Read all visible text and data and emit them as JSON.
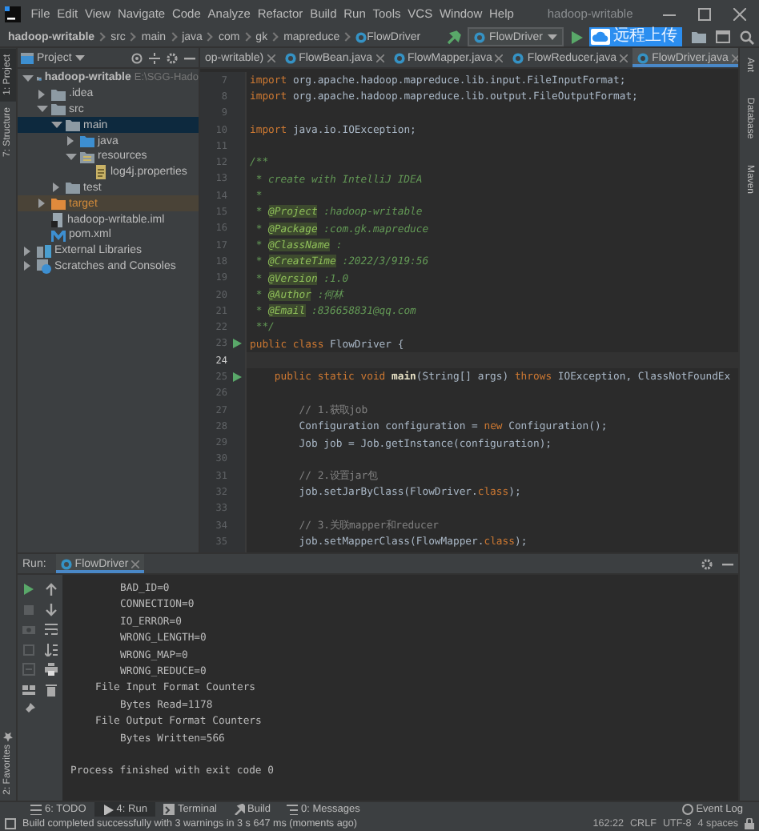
{
  "menubar": {
    "menus": [
      "File",
      "Edit",
      "View",
      "Navigate",
      "Code",
      "Analyze",
      "Refactor",
      "Build",
      "Run",
      "Tools",
      "VCS",
      "Window",
      "Help"
    ],
    "title": "hadoop-writable"
  },
  "navbar": {
    "breadcrumbs": [
      "hadoop-writable",
      "src",
      "main",
      "java",
      "com",
      "gk",
      "mapreduce",
      "FlowDriver"
    ],
    "run_config": "FlowDriver",
    "upload_button": "远程上传"
  },
  "left_strip": {
    "top": [
      {
        "label": "1: Project",
        "selected": true
      },
      {
        "label": "7: Structure",
        "selected": false
      }
    ],
    "bottom": [
      {
        "label": "2: Favorites",
        "selected": false
      }
    ]
  },
  "right_strip": [
    "Ant",
    "Database",
    "Maven"
  ],
  "project": {
    "title": "Project",
    "tree": [
      {
        "label": "hadoop-writable",
        "note": "E:\\SGG-Hado",
        "kind": "module",
        "expanded": true,
        "selected": false,
        "children": [
          {
            "label": ".idea",
            "kind": "folder",
            "expanded": false,
            "selected": false
          },
          {
            "label": "src",
            "kind": "folder",
            "expanded": true,
            "selected": false,
            "children": [
              {
                "label": "main",
                "kind": "folder",
                "expanded": true,
                "selected": true,
                "children": [
                  {
                    "label": "java",
                    "kind": "source_folder",
                    "expanded": false,
                    "selected": false
                  },
                  {
                    "label": "resources",
                    "kind": "resource_folder",
                    "expanded": true,
                    "selected": false,
                    "children": [
                      {
                        "label": "log4j.properties",
                        "kind": "properties",
                        "selected": false
                      }
                    ]
                  }
                ]
              },
              {
                "label": "test",
                "kind": "folder",
                "expanded": false,
                "selected": false
              }
            ]
          },
          {
            "label": "target",
            "kind": "excluded_folder",
            "expanded": false,
            "selected": false
          },
          {
            "label": "hadoop-writable.iml",
            "kind": "iml",
            "selected": false
          },
          {
            "label": "pom.xml",
            "kind": "pom",
            "selected": false
          }
        ]
      },
      {
        "label": "External Libraries",
        "kind": "libraries",
        "expanded": false,
        "selected": false
      },
      {
        "label": "Scratches and Consoles",
        "kind": "scratches",
        "expanded": false,
        "selected": false
      }
    ]
  },
  "editor": {
    "tabs": [
      {
        "label": "op-writable)",
        "selected": false
      },
      {
        "label": "FlowBean.java",
        "selected": false
      },
      {
        "label": "FlowMapper.java",
        "selected": false
      },
      {
        "label": "FlowReducer.java",
        "selected": false
      },
      {
        "label": "FlowDriver.java",
        "selected": true
      }
    ],
    "lines": [
      {
        "number": "7",
        "current": false,
        "tokens": [
          {
            "kind": "keyword",
            "text": "import "
          },
          {
            "kind": "plain",
            "text": "org.apache.hadoop.mapreduce.lib.input.FileInputFormat;"
          }
        ]
      },
      {
        "number": "8",
        "current": false,
        "tokens": [
          {
            "kind": "keyword",
            "text": "import "
          },
          {
            "kind": "plain",
            "text": "org.apache.hadoop.mapreduce.lib.output.FileOutputFormat;"
          }
        ]
      },
      {
        "number": "9",
        "current": false
      },
      {
        "number": "10",
        "current": false,
        "tokens": [
          {
            "kind": "keyword",
            "text": "import "
          },
          {
            "kind": "plain",
            "text": "java.io.IOException;"
          }
        ]
      },
      {
        "number": "11",
        "current": false
      },
      {
        "number": "12",
        "current": false,
        "tokens": [
          {
            "kind": "doc",
            "text": "/**"
          }
        ]
      },
      {
        "number": "13",
        "current": false,
        "tokens": [
          {
            "kind": "doc",
            "text": " * create with IntelliJ IDEA"
          }
        ]
      },
      {
        "number": "14",
        "current": false,
        "tokens": [
          {
            "kind": "doc",
            "text": " *"
          }
        ]
      },
      {
        "number": "15",
        "current": false,
        "tokens": [
          {
            "kind": "doc",
            "text": " * "
          },
          {
            "kind": "doc_tag",
            "text": "@Project"
          },
          {
            "kind": "doc",
            "text": " :hadoop-writable"
          }
        ]
      },
      {
        "number": "16",
        "current": false,
        "tokens": [
          {
            "kind": "doc",
            "text": " * "
          },
          {
            "kind": "doc_tag",
            "text": "@Package"
          },
          {
            "kind": "doc",
            "text": " :com.gk.mapreduce"
          }
        ]
      },
      {
        "number": "17",
        "current": false,
        "tokens": [
          {
            "kind": "doc",
            "text": " * "
          },
          {
            "kind": "doc_tag",
            "text": "@ClassName"
          },
          {
            "kind": "doc",
            "text": " :"
          }
        ]
      },
      {
        "number": "18",
        "current": false,
        "tokens": [
          {
            "kind": "doc",
            "text": " * "
          },
          {
            "kind": "doc_tag",
            "text": "@CreateTime"
          },
          {
            "kind": "doc",
            "text": " :2022/3/919:56"
          }
        ]
      },
      {
        "number": "19",
        "current": false,
        "tokens": [
          {
            "kind": "doc",
            "text": " * "
          },
          {
            "kind": "doc_tag",
            "text": "@Version"
          },
          {
            "kind": "doc",
            "text": " :1.0"
          }
        ]
      },
      {
        "number": "20",
        "current": false,
        "tokens": [
          {
            "kind": "doc",
            "text": " * "
          },
          {
            "kind": "doc_tag",
            "text": "@Author"
          },
          {
            "kind": "doc",
            "text": " :何林"
          }
        ]
      },
      {
        "number": "21",
        "current": false,
        "tokens": [
          {
            "kind": "doc",
            "text": " * "
          },
          {
            "kind": "doc_tag",
            "text": "@Email"
          },
          {
            "kind": "doc",
            "text": " :836658831@qq.com"
          }
        ]
      },
      {
        "number": "22",
        "current": false,
        "tokens": [
          {
            "kind": "doc",
            "text": " **/"
          }
        ]
      },
      {
        "number": "23",
        "current": false,
        "runnable": true,
        "tokens": [
          {
            "kind": "keyword",
            "text": "public class "
          },
          {
            "kind": "plain",
            "text": "FlowDriver {"
          }
        ]
      },
      {
        "number": "24",
        "current": true
      },
      {
        "number": "25",
        "current": false,
        "runnable": true,
        "tokens": [
          {
            "kind": "keyword",
            "text": "    public static void "
          },
          {
            "kind": "method",
            "text": "main"
          },
          {
            "kind": "plain",
            "text": "(String[] args) "
          },
          {
            "kind": "keyword",
            "text": "throws "
          },
          {
            "kind": "plain",
            "text": "IOException, ClassNotFoundEx"
          }
        ]
      },
      {
        "number": "26",
        "current": false
      },
      {
        "number": "27",
        "current": false,
        "tokens": [
          {
            "kind": "comment",
            "text": "        // 1.获取job"
          }
        ]
      },
      {
        "number": "28",
        "current": false,
        "tokens": [
          {
            "kind": "plain",
            "text": "        Configuration configuration = "
          },
          {
            "kind": "keyword",
            "text": "new "
          },
          {
            "kind": "plain",
            "text": "Configuration();"
          }
        ]
      },
      {
        "number": "29",
        "current": false,
        "tokens": [
          {
            "kind": "plain",
            "text": "        Job job = Job.getInstance(configuration);"
          }
        ]
      },
      {
        "number": "30",
        "current": false
      },
      {
        "number": "31",
        "current": false,
        "tokens": [
          {
            "kind": "comment",
            "text": "        // 2.设置jar包"
          }
        ]
      },
      {
        "number": "32",
        "current": false,
        "tokens": [
          {
            "kind": "plain",
            "text": "        job.setJarByClass(FlowDriver."
          },
          {
            "kind": "keyword",
            "text": "class"
          },
          {
            "kind": "plain",
            "text": ");"
          }
        ]
      },
      {
        "number": "33",
        "current": false
      },
      {
        "number": "34",
        "current": false,
        "tokens": [
          {
            "kind": "comment",
            "text": "        // 3.关联mapper和reducer"
          }
        ]
      },
      {
        "number": "35",
        "current": false,
        "tokens": [
          {
            "kind": "plain",
            "text": "        job.setMapperClass(FlowMapper."
          },
          {
            "kind": "keyword",
            "text": "class"
          },
          {
            "kind": "plain",
            "text": ");"
          }
        ]
      }
    ]
  },
  "run": {
    "label": "Run:",
    "tab": "FlowDriver",
    "console": [
      {
        "kind": "counter",
        "text": "BAD_ID=0"
      },
      {
        "kind": "counter",
        "text": "CONNECTION=0"
      },
      {
        "kind": "counter",
        "text": "IO_ERROR=0"
      },
      {
        "kind": "counter",
        "text": "WRONG_LENGTH=0"
      },
      {
        "kind": "counter",
        "text": "WRONG_MAP=0"
      },
      {
        "kind": "counter",
        "text": "WRONG_REDUCE=0"
      },
      {
        "kind": "group",
        "text": "File Input Format Counters"
      },
      {
        "kind": "counter",
        "text": "Bytes Read=1178"
      },
      {
        "kind": "group",
        "text": "File Output Format Counters"
      },
      {
        "kind": "counter",
        "text": "Bytes Written=566"
      },
      {
        "kind": "result",
        "text": "Process finished with exit code 0"
      }
    ]
  },
  "tool_tabs": [
    {
      "label": "6: TODO",
      "kind": "todo",
      "selected": false
    },
    {
      "label": "4: Run",
      "kind": "run",
      "selected": true
    },
    {
      "label": "Terminal",
      "kind": "terminal",
      "selected": false
    },
    {
      "label": "Build",
      "kind": "build",
      "selected": false
    },
    {
      "label": "0: Messages",
      "kind": "messages",
      "selected": false
    }
  ],
  "event_log": "Event Log",
  "status_bar": {
    "message": "Build completed successfully with 3 warnings in 3 s 647 ms (moments ago)",
    "position": "162:22",
    "line_separator": "CRLF",
    "encoding": "UTF-8",
    "indent": "4 spaces"
  }
}
